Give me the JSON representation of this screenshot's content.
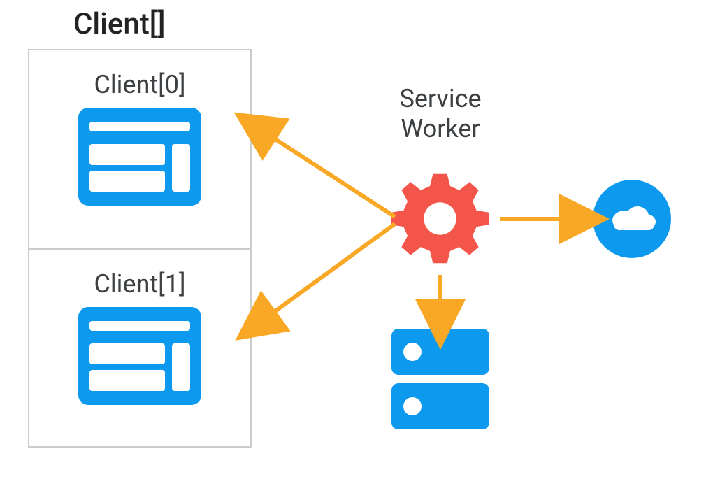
{
  "title": "Client[]",
  "clients": [
    {
      "label": "Client[0]"
    },
    {
      "label": "Client[1]"
    }
  ],
  "serviceWorker": {
    "labelLine1": "Service",
    "labelLine2": "Worker"
  },
  "colors": {
    "blue": "#0d9aee",
    "red": "#f3554a",
    "orange": "#f9a825",
    "border": "#cccccc",
    "text": "#3c4043"
  },
  "icons": {
    "client0": "browser-window-icon",
    "client1": "browser-window-icon",
    "serviceWorker": "gear-icon",
    "cloud": "cloud-icon",
    "server": "server-icon"
  }
}
